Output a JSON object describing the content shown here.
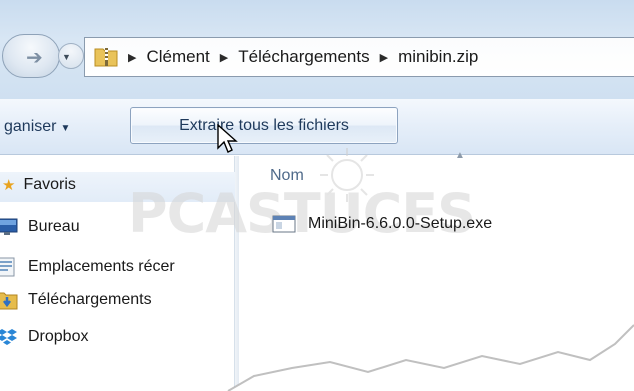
{
  "address": {
    "crumbs": [
      "Clément",
      "Téléchargements",
      "minibin.zip"
    ]
  },
  "toolbar": {
    "organize_label": "ganiser",
    "extract_label": "Extraire tous les fichiers"
  },
  "nav": {
    "items": [
      {
        "label": "Favoris",
        "icon": "star-icon"
      },
      {
        "label": "Bureau",
        "icon": "desktop-icon"
      },
      {
        "label": "Emplacements récer",
        "icon": "recent-places-icon"
      },
      {
        "label": "Téléchargements",
        "icon": "downloads-folder-icon"
      },
      {
        "label": "Dropbox",
        "icon": "dropbox-icon"
      }
    ]
  },
  "content": {
    "column_header": "Nom",
    "files": [
      {
        "name": "MiniBin-6.6.0.0-Setup.exe",
        "icon": "exe-file-icon"
      }
    ]
  },
  "watermark": "PCASTUCES",
  "colors": {
    "header_bg": "#cfe0f1",
    "toolbar_text": "#1e395b",
    "column_header_text": "#4f6a8a",
    "favorites_highlight": "#e2ecf8"
  }
}
